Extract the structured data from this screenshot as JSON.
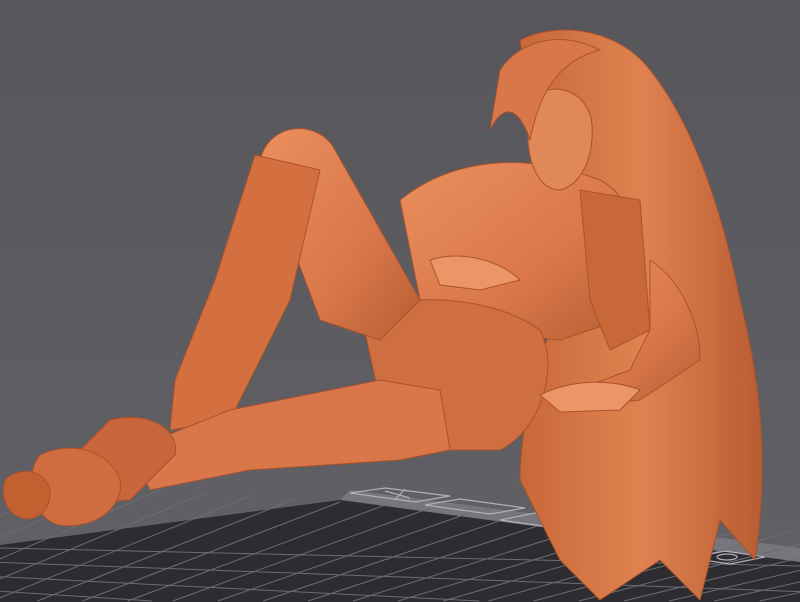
{
  "viewport": {
    "background_color": "#5b5b60",
    "model_color": "#d9774a",
    "model_shadow_color": "#a9532c",
    "model_highlight_color": "#ec9566",
    "bed_color": "#2c2c31",
    "bed_grid_color": "#6c6c74",
    "bed_edge_color": "#76767c"
  },
  "bed_icons": [
    "x-axis-icon",
    "printer-logo-icon",
    "label-icon",
    "origin-icon"
  ]
}
